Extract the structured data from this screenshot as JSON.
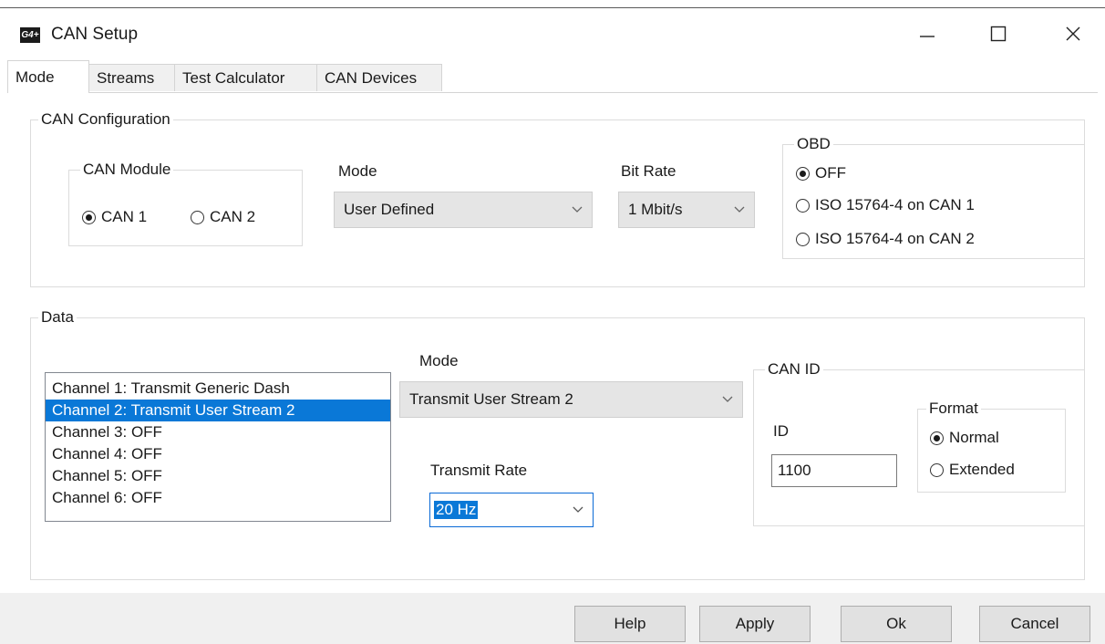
{
  "window": {
    "logo_text": "G4+",
    "title": "CAN Setup",
    "icons": {
      "minimize": "minimize-icon",
      "maximize": "maximize-icon",
      "close": "close-icon"
    }
  },
  "tabs": [
    {
      "label": "Mode",
      "active": true
    },
    {
      "label": "Streams",
      "active": false
    },
    {
      "label": "Test Calculator",
      "active": false
    },
    {
      "label": "CAN Devices",
      "active": false
    }
  ],
  "can_config": {
    "group_label": "CAN Configuration",
    "can_module": {
      "label": "CAN Module",
      "options": [
        {
          "label": "CAN 1",
          "selected": true
        },
        {
          "label": "CAN 2",
          "selected": false
        }
      ]
    },
    "mode": {
      "label": "Mode",
      "value": "User Defined"
    },
    "bit_rate": {
      "label": "Bit Rate",
      "value": "1 Mbit/s"
    },
    "obd": {
      "label": "OBD",
      "options": [
        {
          "label": "OFF",
          "selected": true
        },
        {
          "label": "ISO 15764-4 on CAN 1",
          "selected": false
        },
        {
          "label": "ISO 15764-4 on CAN 2",
          "selected": false
        }
      ]
    }
  },
  "data": {
    "group_label": "Data",
    "channels": [
      {
        "label": "Channel 1: Transmit Generic Dash",
        "selected": false
      },
      {
        "label": "Channel 2: Transmit User Stream 2",
        "selected": true
      },
      {
        "label": "Channel 3: OFF",
        "selected": false
      },
      {
        "label": "Channel 4: OFF",
        "selected": false
      },
      {
        "label": "Channel 5: OFF",
        "selected": false
      },
      {
        "label": "Channel 6: OFF",
        "selected": false
      }
    ],
    "mode": {
      "label": "Mode",
      "value": "Transmit User Stream 2"
    },
    "transmit_rate": {
      "label": "Transmit Rate",
      "value": "20 Hz"
    },
    "can_id": {
      "group_label": "CAN ID",
      "id_label": "ID",
      "id_value": "1100",
      "format": {
        "label": "Format",
        "options": [
          {
            "label": "Normal",
            "selected": true
          },
          {
            "label": "Extended",
            "selected": false
          }
        ]
      }
    }
  },
  "buttons": {
    "help": "Help",
    "apply": "Apply",
    "ok": "Ok",
    "cancel": "Cancel"
  },
  "colors": {
    "selection": "#0a78d7",
    "focus_border": "#0a6ad6",
    "bottom_bar": "#f0f0f0"
  }
}
